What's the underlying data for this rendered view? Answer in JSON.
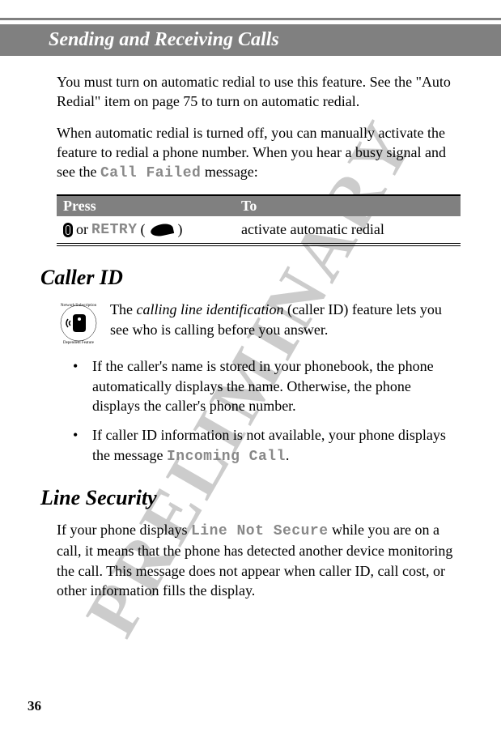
{
  "watermark": "PRELIMINARY",
  "header": "Sending and Receiving Calls",
  "para1": "You must turn on automatic redial to use this feature. See the \"Auto Redial\" item on page 75 to turn on automatic redial.",
  "para2_pre": "When automatic redial is turned off, you can manually activate the feature to redial a phone number. When you hear a busy signal and see the ",
  "para2_mono": "Call Failed",
  "para2_post": " message:",
  "table": {
    "h1": "Press",
    "h2": "To",
    "row1_or": " or ",
    "row1_retry": "RETRY",
    "row1_open": " (",
    "row1_close": ")",
    "row1_to": "activate automatic redial"
  },
  "sections": {
    "caller_id": {
      "heading": "Caller ID",
      "intro_pre": "The ",
      "intro_italic": "calling line identification",
      "intro_post": " (caller ID) feature lets you see who is calling before you answer.",
      "bullets": [
        "If the caller's name is stored in your phonebook, the phone automatically displays the name. Otherwise, the phone displays the caller's phone number.",
        ""
      ],
      "b2_pre": "If caller ID information is not available, your phone displays the message ",
      "b2_mono": "Incoming Call",
      "b2_post": "."
    },
    "line_security": {
      "heading": "Line Security",
      "para_pre": "If your phone displays ",
      "para_mono": "Line Not Secure",
      "para_post": " while you are on a call, it means that the phone has detected another device monitoring the call. This message does not appear when caller ID, call cost, or other information fills the display."
    }
  },
  "page_number": "36"
}
